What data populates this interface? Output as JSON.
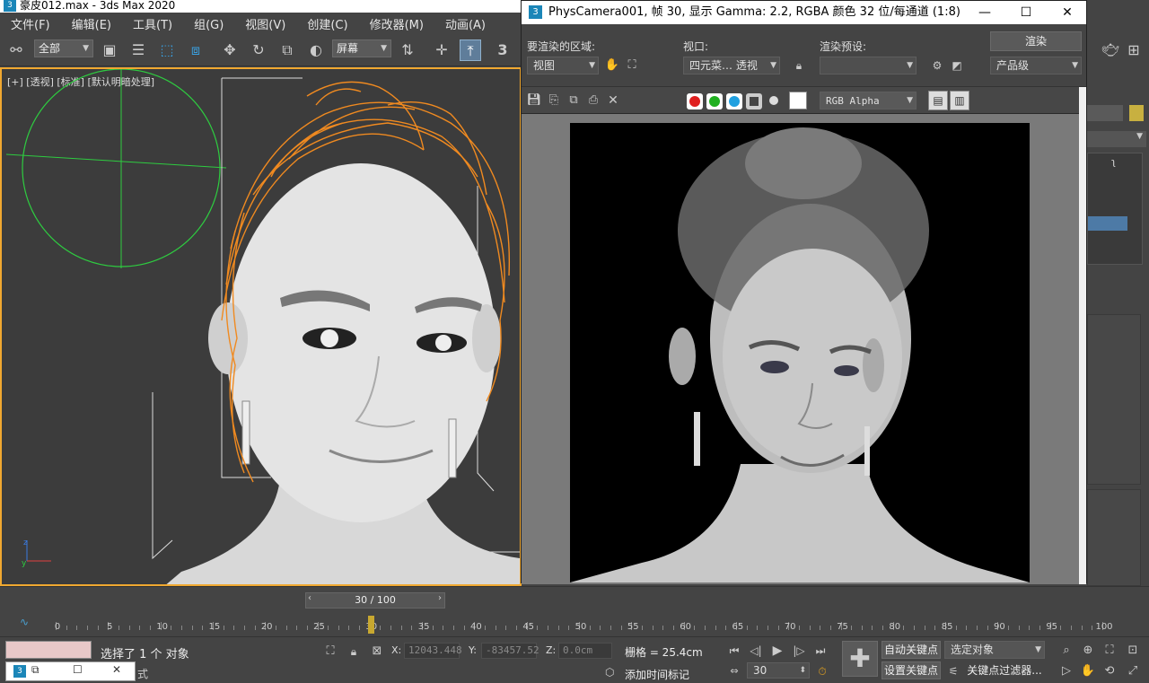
{
  "app": {
    "title": "豪皮012.max - 3ds Max 2020",
    "logo": "3"
  },
  "menu": {
    "items": [
      "文件(F)",
      "编辑(E)",
      "工具(T)",
      "组(G)",
      "视图(V)",
      "创建(C)",
      "修改器(M)",
      "动画(A)"
    ]
  },
  "toolbar": {
    "selection_filter": "全部",
    "coord_system": "屏幕",
    "snap_toggle_label": "3"
  },
  "viewport": {
    "label": "[+] [透视] [标准] [默认明暗处理]"
  },
  "render_window": {
    "title": "PhysCamera001, 帧 30, 显示 Gamma: 2.2, RGBA 颜色 32 位/每通道 (1:8)",
    "area_label": "要渲染的区域:",
    "area_value": "视图",
    "viewport_label": "视口:",
    "viewport_value": "四元菜… 透视",
    "preset_label": "渲染预设:",
    "preset_value": "",
    "render_button": "渲染",
    "quality_value": "产品级",
    "channel_value": "RGB Alpha",
    "channel_colors": {
      "red": "#e02020",
      "green": "#20b020",
      "blue": "#20a0e0"
    }
  },
  "timeline": {
    "frame_display": "30 / 100",
    "current_frame": 30,
    "total_frames": 100,
    "tick_labels": [
      "0",
      "5",
      "10",
      "15",
      "20",
      "25",
      "30",
      "35",
      "40",
      "45",
      "50",
      "55",
      "60",
      "65",
      "70",
      "75",
      "80",
      "85",
      "90",
      "95",
      "100"
    ]
  },
  "status": {
    "selection_text": "选择了 1 个 对象",
    "x_label": "X:",
    "x_value": "12043.448",
    "y_label": "Y:",
    "y_value": "-83457.52",
    "z_label": "Z:",
    "z_value": "0.0cm",
    "grid_text": "栅格 = 25.4cm",
    "add_time_tag": "添加时间标记",
    "auto_key": "自动关键点",
    "set_key": "设置关键点",
    "selected_object": "选定对象",
    "key_filter": "关键点过滤器...",
    "frame_value": "30",
    "script_label": "式"
  },
  "colors": {
    "accent_orange": "#f0a830",
    "hair_orange": "#f08a20",
    "helper_green": "#2ecc40",
    "panel_bg": "#444444"
  }
}
